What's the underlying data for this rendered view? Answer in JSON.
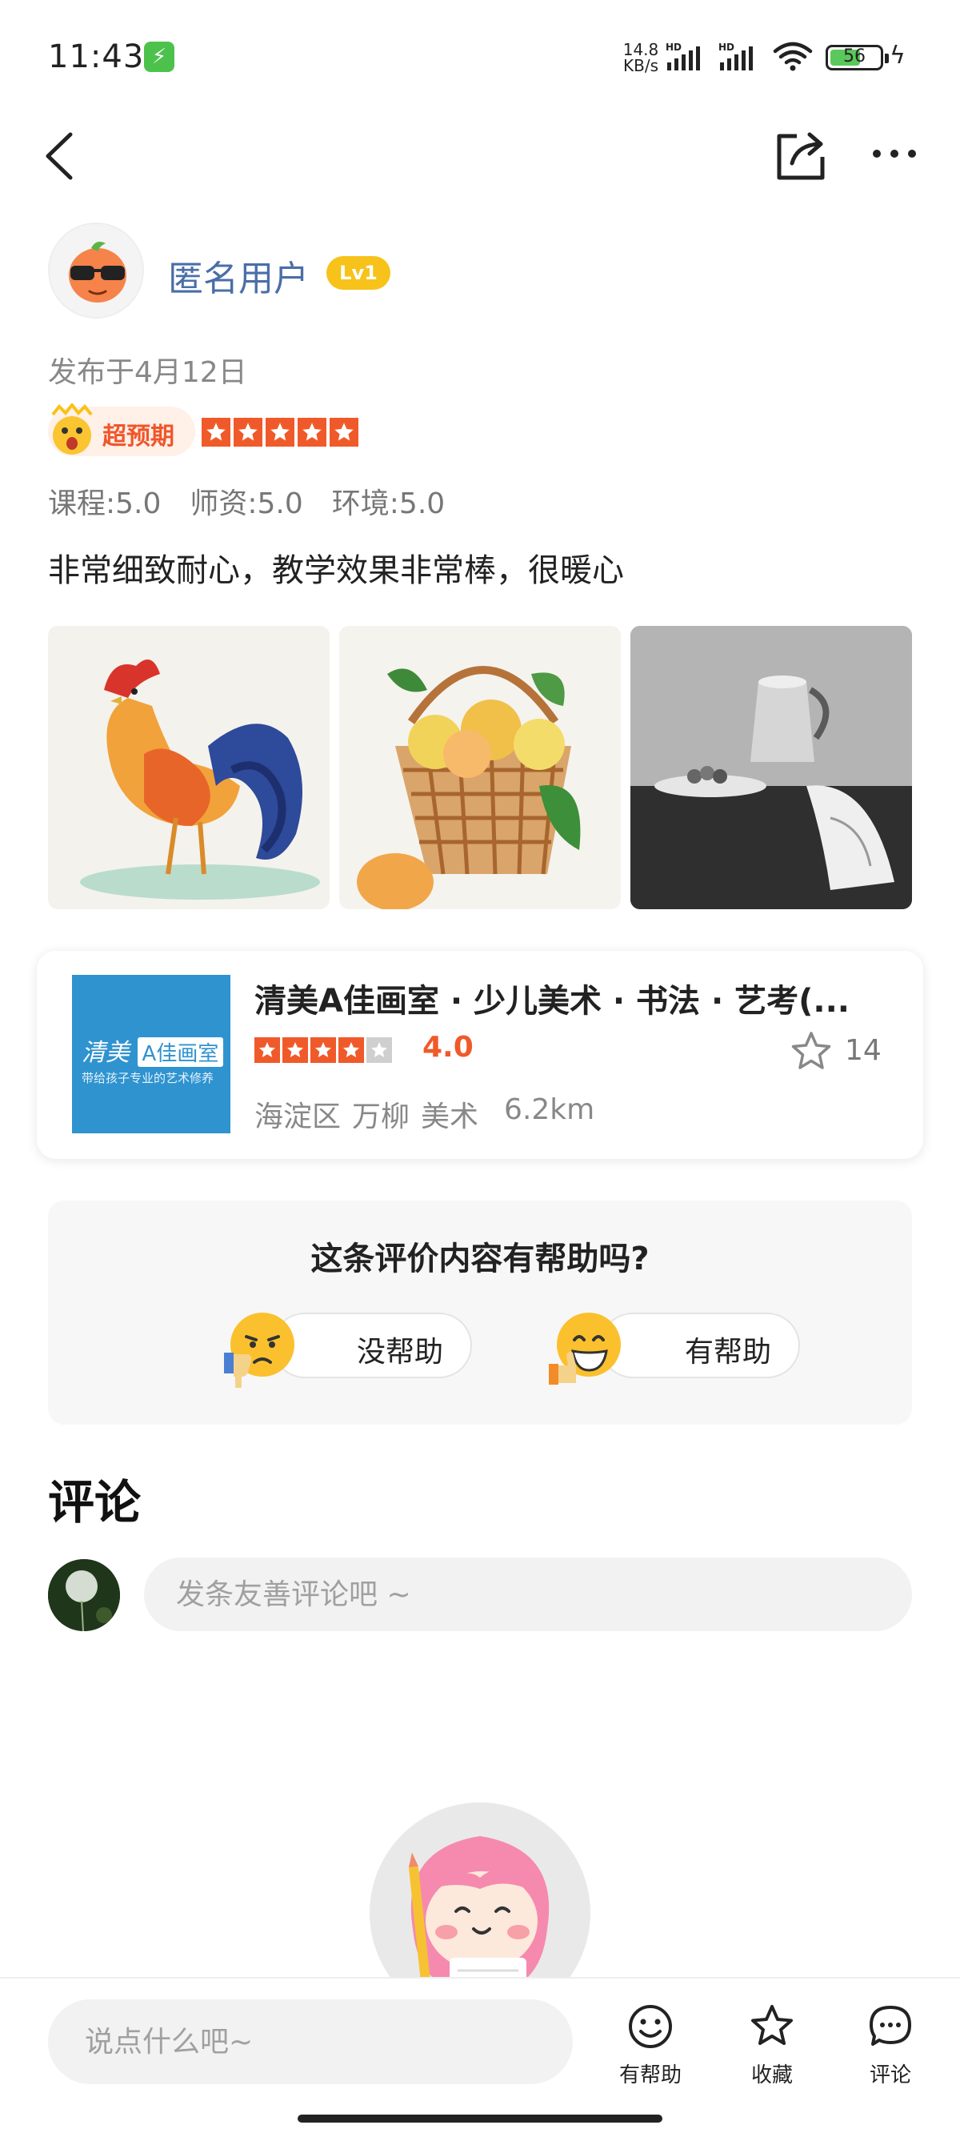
{
  "status_bar": {
    "time": "11:43",
    "net_speed_value": "14.8",
    "net_speed_unit": "KB/s",
    "signal_label": "HD",
    "battery_level": 56,
    "battery_text": "56"
  },
  "review": {
    "username": "匿名用户",
    "level": "Lv1",
    "publish_date": "发布于4月12日",
    "rating_tag": "超预期",
    "stars": 5,
    "sub_scores": [
      "课程:5.0",
      "师资:5.0",
      "环境:5.0"
    ],
    "text": "非常细致耐心，教学效果非常棒，很暖心",
    "photos": [
      "rooster-watercolor",
      "fruit-basket-watercolor",
      "still-life-sketch"
    ]
  },
  "shop": {
    "name": "清美A佳画室 · 少儿美术 · 书法 · 艺考(...",
    "logo_text_left": "清美",
    "logo_text_box": "A佳画室",
    "logo_subtitle": "带给孩子专业的艺术修养",
    "rating_value": 4.0,
    "rating": "4.0",
    "favorites": "14",
    "district": "海淀区",
    "area": "万柳",
    "category": "美术",
    "distance": "6.2km"
  },
  "helpful": {
    "question": "这条评价内容有帮助吗?",
    "not_helpful": "没帮助",
    "helpful": "有帮助"
  },
  "comments": {
    "title": "评论",
    "placeholder": "发条友善评论吧 ~"
  },
  "bottom_bar": {
    "input_placeholder": "说点什么吧~",
    "helpful_label": "有帮助",
    "favorite_label": "收藏",
    "comment_label": "评论"
  },
  "colors": {
    "accent": "#f05a2a",
    "username": "#4a6ea8",
    "level_badge": "#f7c21a",
    "shop_logo_bg": "#2f93cf"
  }
}
